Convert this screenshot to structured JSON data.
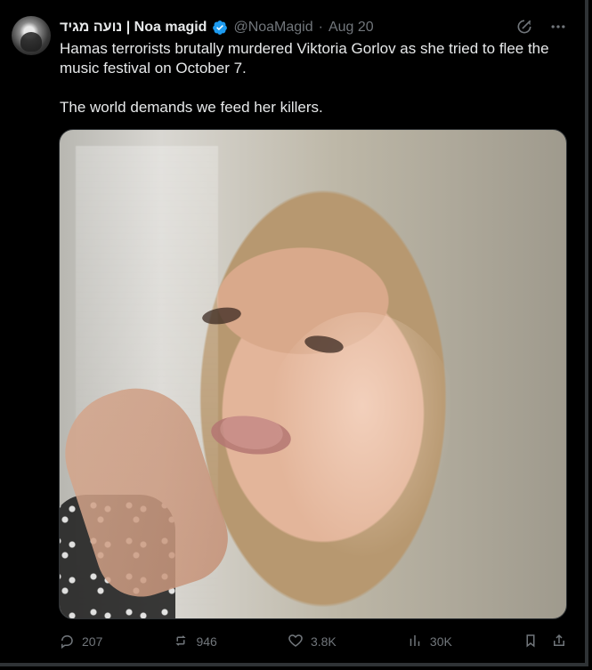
{
  "tweet": {
    "author": {
      "display_name": "נועה מגיד | Noa magid",
      "handle": "@NoaMagid"
    },
    "date": "Aug 20",
    "text": {
      "line1": "Hamas terrorists brutally murdered Viktoria Gorlov as she tried to flee the music festival on October 7.",
      "line2": "The world demands we feed her killers."
    },
    "actions": {
      "replies": "207",
      "reposts": "946",
      "likes": "3.8K",
      "views": "30K"
    }
  },
  "colors": {
    "background": "#000000",
    "text": "#e7e9ea",
    "muted": "#71767b",
    "verified_blue": "#1d9bf0",
    "border": "#2f3336"
  },
  "icons": {
    "verified": "verified-badge-icon",
    "grok": "grok-icon",
    "more": "more-icon",
    "reply": "reply-icon",
    "repost": "repost-icon",
    "like": "like-icon",
    "views": "views-icon",
    "bookmark": "bookmark-icon",
    "share": "share-icon"
  }
}
